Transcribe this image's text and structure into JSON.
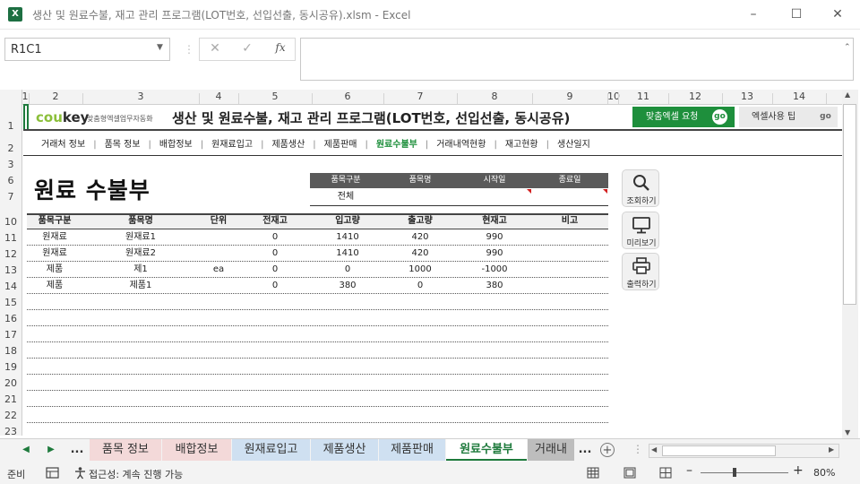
{
  "window": {
    "title": "생산 및 원료수불, 재고 관리 프로그램(LOT번호, 선입선출, 동시공유).xlsm  -  Excel",
    "app_icon": "X"
  },
  "formula_bar": {
    "name_box": "R1C1",
    "fx": "fx",
    "formula": ""
  },
  "columns": [
    "1",
    "2",
    "3",
    "4",
    "5",
    "6",
    "7",
    "8",
    "9",
    "10",
    "11",
    "12",
    "13",
    "14"
  ],
  "rows": [
    "1",
    "2",
    "3",
    "6",
    "7",
    "10",
    "11",
    "12",
    "13",
    "14",
    "15",
    "16",
    "17",
    "18",
    "19",
    "20",
    "21",
    "22",
    "23"
  ],
  "banner": {
    "logo_a": "cou",
    "logo_b": "key",
    "logo_sub": "맞춤형엑셀업무자동화",
    "title": "생산 및 원료수불, 재고 관리 프로그램(LOT번호, 선입선출, 동시공유)",
    "btn_custom": "맞춤엑셀 요청",
    "btn_tips": "엑셀사용 팁",
    "go": "go",
    "accent": "#1e8f3c"
  },
  "nav": [
    "거래처 정보",
    "품목 정보",
    "배합정보",
    "원재료입고",
    "제품생산",
    "제품판매",
    "원료수불부",
    "거래내역현황",
    "재고현황",
    "생산일지"
  ],
  "nav_active": "원료수불부",
  "page_heading": "원료 수불부",
  "filter": {
    "headers": [
      "품목구분",
      "품목명",
      "시작일",
      "종료일"
    ],
    "values": [
      "전체",
      "",
      "",
      ""
    ]
  },
  "side_buttons": [
    {
      "label": "조회하기",
      "icon": "search-icon"
    },
    {
      "label": "미리보기",
      "icon": "monitor-icon"
    },
    {
      "label": "출력하기",
      "icon": "printer-icon"
    }
  ],
  "table": {
    "headers": [
      "품목구분",
      "품목명",
      "단위",
      "전재고",
      "입고량",
      "출고량",
      "현재고",
      "비고"
    ],
    "rows": [
      [
        "원재료",
        "원재료1",
        "",
        "0",
        "1410",
        "420",
        "990",
        ""
      ],
      [
        "원재료",
        "원재료2",
        "",
        "0",
        "1410",
        "420",
        "990",
        ""
      ],
      [
        "제품",
        "제1",
        "ea",
        "0",
        "0",
        "1000",
        "-1000",
        ""
      ],
      [
        "제품",
        "제품1",
        "",
        "0",
        "380",
        "0",
        "380",
        ""
      ]
    ]
  },
  "sheet_tabs": {
    "more": "...",
    "tabs": [
      {
        "label": "품목 정보",
        "color": "#f3d9d9"
      },
      {
        "label": "배합정보",
        "color": "#f3d9d9"
      },
      {
        "label": "원재료입고",
        "color": "#cfe0f1"
      },
      {
        "label": "제품생산",
        "color": "#cfe0f1"
      },
      {
        "label": "제품판매",
        "color": "#cfe0f1"
      },
      {
        "label": "원료수불부",
        "color": "#ffffff"
      },
      {
        "label": "거래내",
        "color": "#bdbdbd"
      }
    ],
    "active": "원료수불부"
  },
  "status": {
    "ready": "준비",
    "accessibility": "접근성: 계속 진행 가능",
    "zoom": "80%"
  }
}
